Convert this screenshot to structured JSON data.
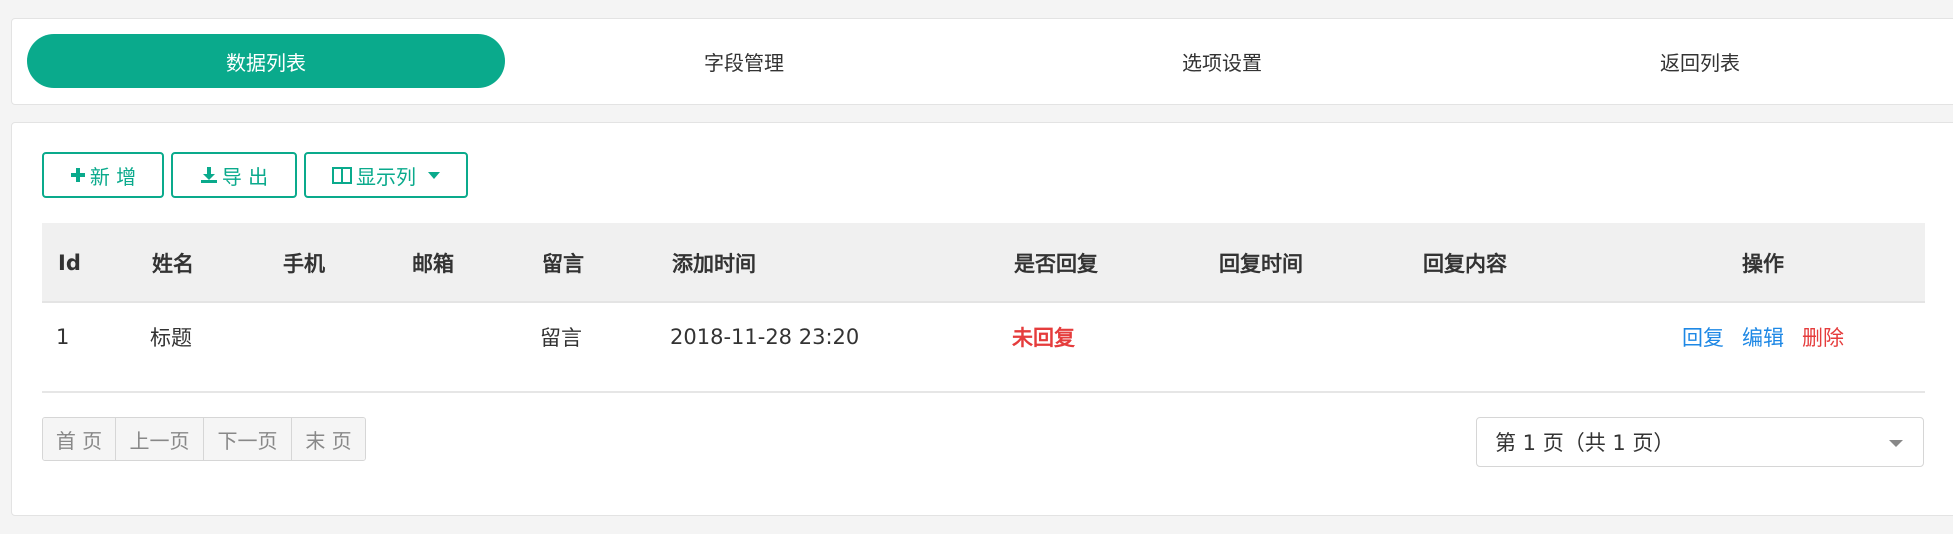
{
  "tabs": [
    {
      "label": "数据列表",
      "active": true
    },
    {
      "label": "字段管理",
      "active": false
    },
    {
      "label": "选项设置",
      "active": false
    },
    {
      "label": "返回列表",
      "active": false
    }
  ],
  "toolbar": {
    "add_label": "新 增",
    "add_icon": "plus-icon",
    "export_label": "导 出",
    "export_icon": "download-icon",
    "columns_label": "显示列",
    "columns_icon": "columns-icon"
  },
  "table": {
    "headers": {
      "id": "Id",
      "name": "姓名",
      "phone": "手机",
      "email": "邮箱",
      "message": "留言",
      "added_time": "添加时间",
      "replied": "是否回复",
      "reply_time": "回复时间",
      "reply_content": "回复内容",
      "actions": "操作"
    },
    "rows": [
      {
        "id": "1",
        "name": "标题",
        "phone": "",
        "email": "",
        "message": "留言",
        "added_time": "2018-11-28 23:20",
        "replied": "未回复",
        "reply_time": "",
        "reply_content": "",
        "actions": {
          "reply": "回复",
          "edit": "编辑",
          "delete": "删除"
        }
      }
    ]
  },
  "pagination": {
    "first": "首 页",
    "prev": "上一页",
    "next": "下一页",
    "last": "末 页",
    "page_select_value": "第 1 页（共 1 页）"
  },
  "colors": {
    "accent": "#0aaa8c",
    "danger": "#e53c3c",
    "link": "#1e88e5"
  }
}
